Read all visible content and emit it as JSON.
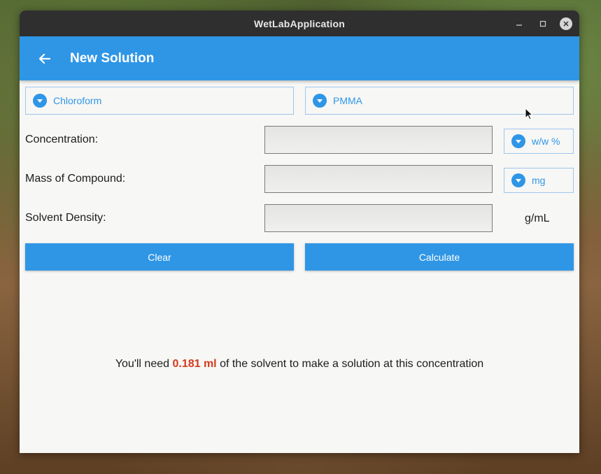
{
  "window": {
    "title": "WetLabApplication"
  },
  "appbar": {
    "title": "New Solution"
  },
  "selectors": {
    "solvent": "Chloroform",
    "compound": "PMMA"
  },
  "form": {
    "concentration_label": "Concentration:",
    "concentration_value": "",
    "concentration_unit": "w/w %",
    "mass_label": "Mass of Compound:",
    "mass_value": "",
    "mass_unit": "mg",
    "density_label": "Solvent Density:",
    "density_value": "",
    "density_unit": "g/mL"
  },
  "buttons": {
    "clear": "Clear",
    "calculate": "Calculate"
  },
  "result": {
    "prefix": "You'll need ",
    "amount": "0.181 ml",
    "suffix": " of the solvent to make a solution at this concentration"
  },
  "colors": {
    "accent": "#2f96e6",
    "highlight": "#d33a1e",
    "titlebar": "#2f2f2f"
  }
}
